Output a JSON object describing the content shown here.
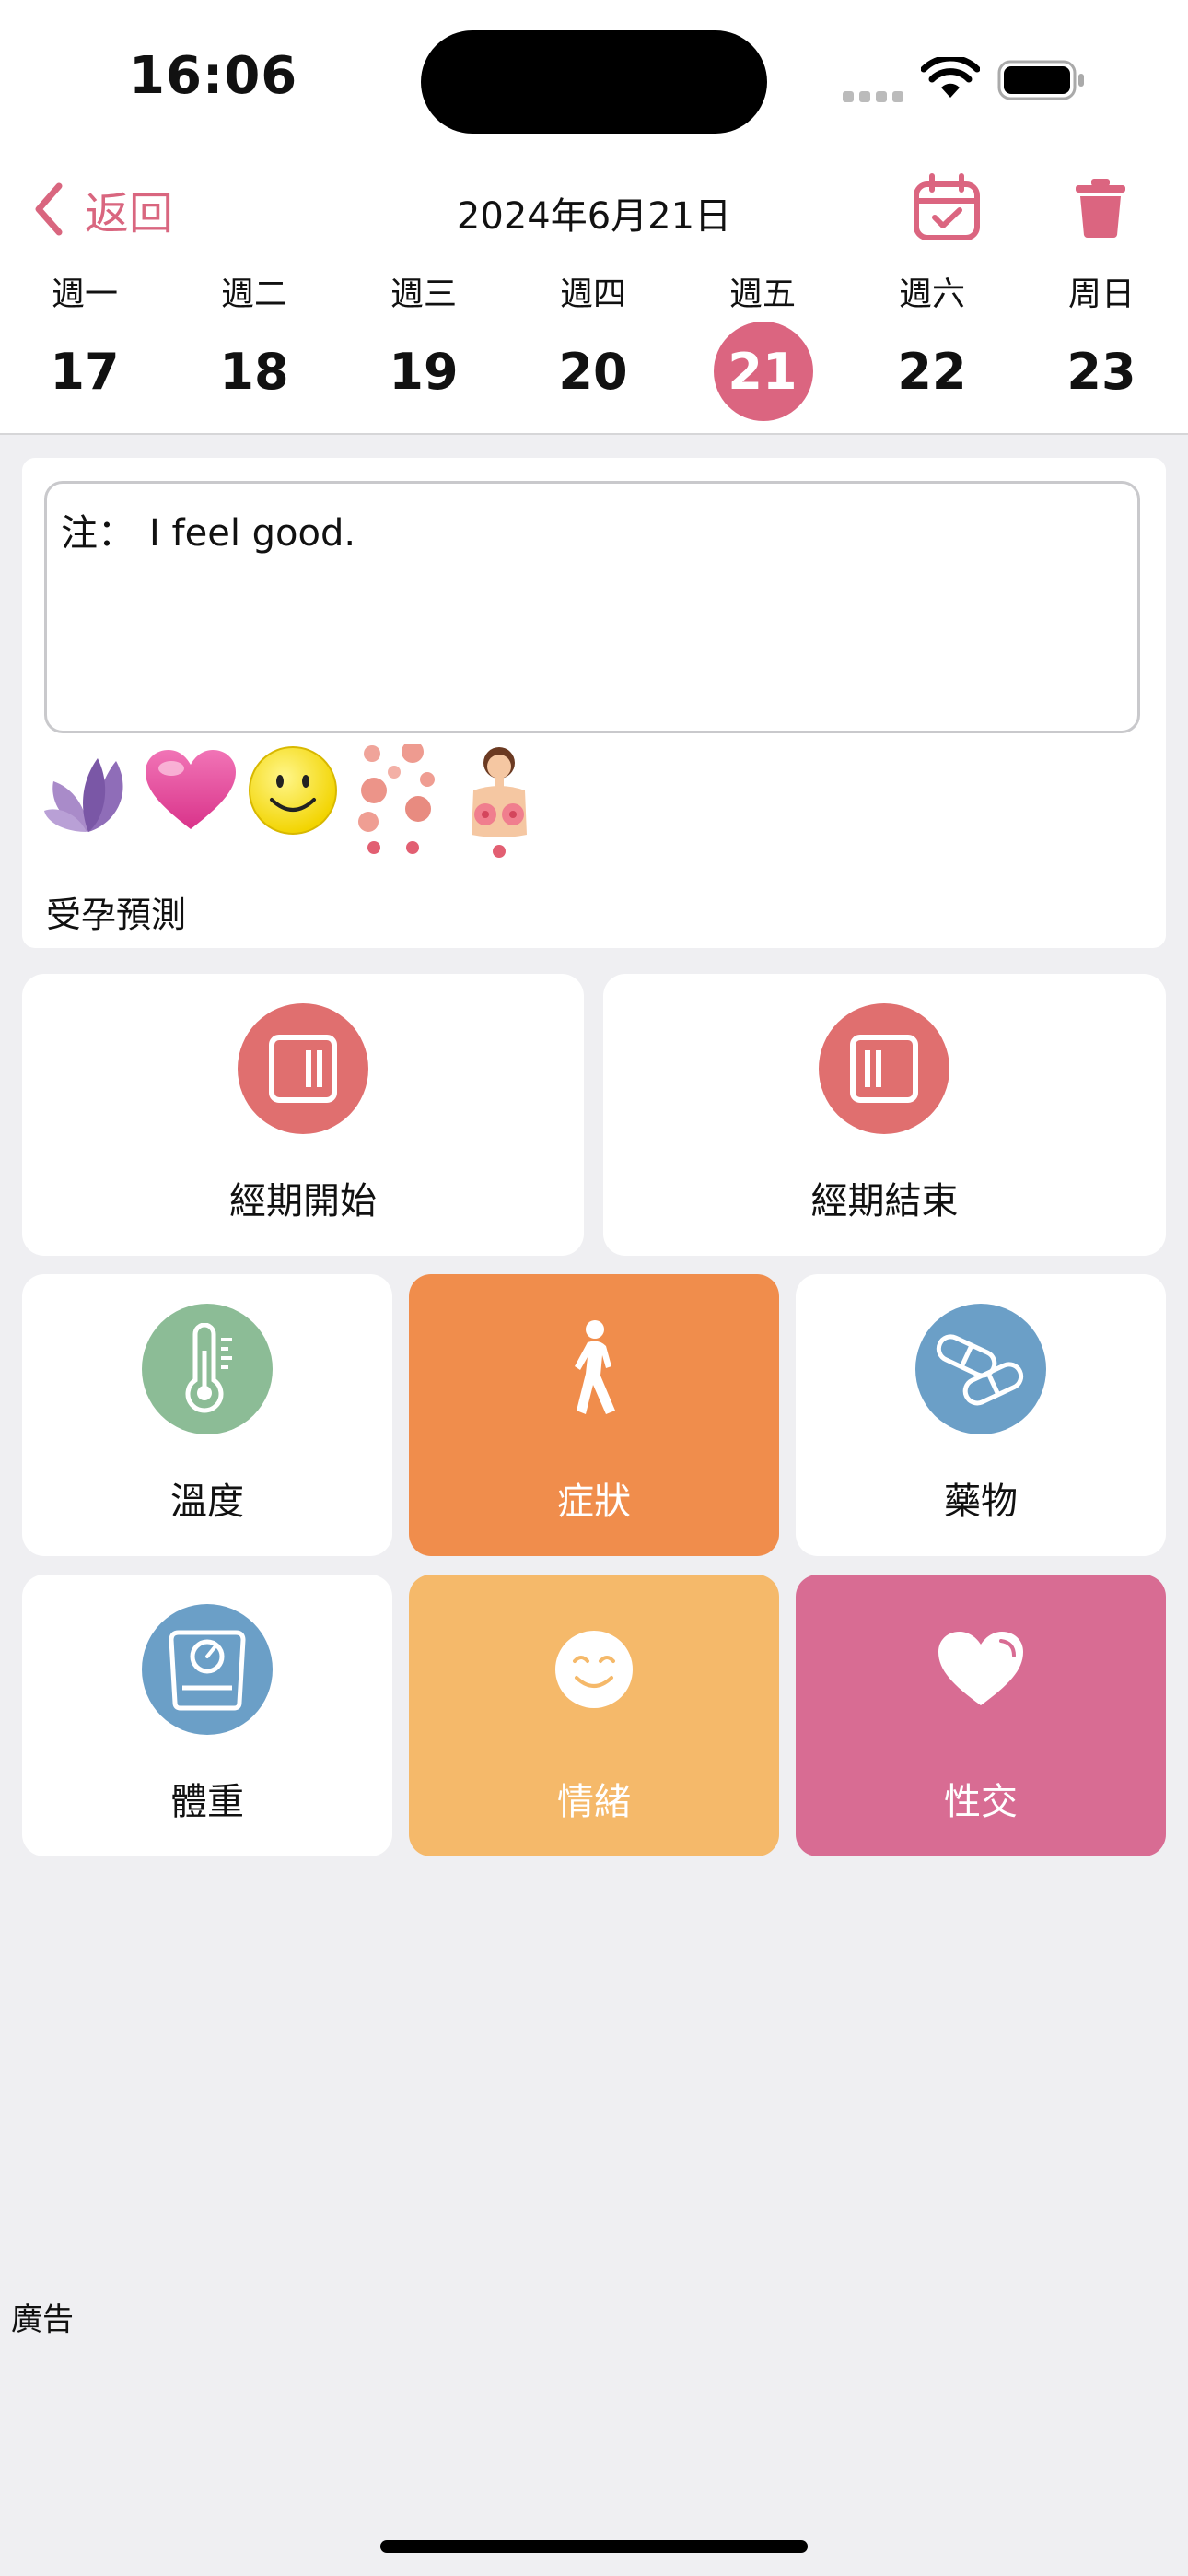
{
  "status_bar": {
    "time": "16:06"
  },
  "header": {
    "back_label": "返回",
    "date_title": "2024年6月21日"
  },
  "week": {
    "days": [
      {
        "label": "週一",
        "number": "17"
      },
      {
        "label": "週二",
        "number": "18"
      },
      {
        "label": "週三",
        "number": "19"
      },
      {
        "label": "週四",
        "number": "20"
      },
      {
        "label": "週五",
        "number": "21"
      },
      {
        "label": "週六",
        "number": "22"
      },
      {
        "label": "周日",
        "number": "23"
      }
    ],
    "selected_index": 4
  },
  "note": {
    "prefix": "注：",
    "text": "I feel good."
  },
  "emoji_icons": [
    "lotus-icon",
    "heart-icon",
    "smiley-icon",
    "cells-icon",
    "breasts-icon"
  ],
  "fertility_label": "受孕預測",
  "tiles": {
    "period_start": "經期開始",
    "period_end": "經期結束",
    "temperature": "溫度",
    "symptoms": "症狀",
    "medication": "藥物",
    "weight": "體重",
    "mood": "情緒",
    "sex": "性交"
  },
  "ad_label": "廣告",
  "colors": {
    "accent": "#db6580",
    "period": "#e06f6f",
    "temperature": "#8cbc96",
    "symptoms_bg": "#f08d4c",
    "medication": "#6b9fc7",
    "weight": "#6b9fc7",
    "mood_bg": "#f5b96a",
    "sex_bg": "#d86c93"
  }
}
